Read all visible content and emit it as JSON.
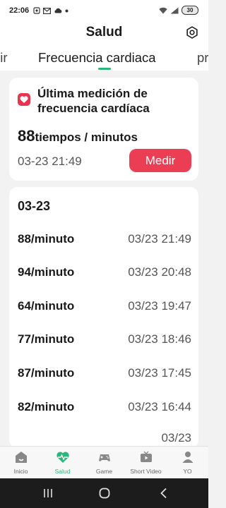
{
  "status_bar": {
    "time": "22:06",
    "battery": "30"
  },
  "header": {
    "title": "Salud"
  },
  "tabs": {
    "prev": "nir",
    "active": "Frecuencia cardiaca",
    "next": "pr"
  },
  "latest": {
    "title": "Última medición de frecuencia cardíaca",
    "value": "88",
    "unit": "tiempos / minutos",
    "time": "03-23 21:49",
    "measure_label": "Medir"
  },
  "history": {
    "date": "03-23",
    "rows": [
      {
        "rate": "88/minuto",
        "time": "03/23 21:49"
      },
      {
        "rate": "94/minuto",
        "time": "03/23 20:48"
      },
      {
        "rate": "64/minuto",
        "time": "03/23 19:47"
      },
      {
        "rate": "77/minuto",
        "time": "03/23 18:46"
      },
      {
        "rate": "87/minuto",
        "time": "03/23 17:45"
      },
      {
        "rate": "82/minuto",
        "time": "03/23 16:44"
      },
      {
        "rate": "",
        "time": "03/23"
      }
    ]
  },
  "bottom_nav": [
    {
      "label": "Inicio",
      "icon": "home-icon"
    },
    {
      "label": "Salud",
      "icon": "heart-pulse-icon",
      "active": true
    },
    {
      "label": "Game",
      "icon": "gamepad-icon"
    },
    {
      "label": "Short Video",
      "icon": "tv-icon"
    },
    {
      "label": "YO",
      "icon": "person-icon"
    }
  ],
  "colors": {
    "accent": "#2db67c",
    "measure_button": "#eb3e55",
    "heart": "#e8344f"
  }
}
